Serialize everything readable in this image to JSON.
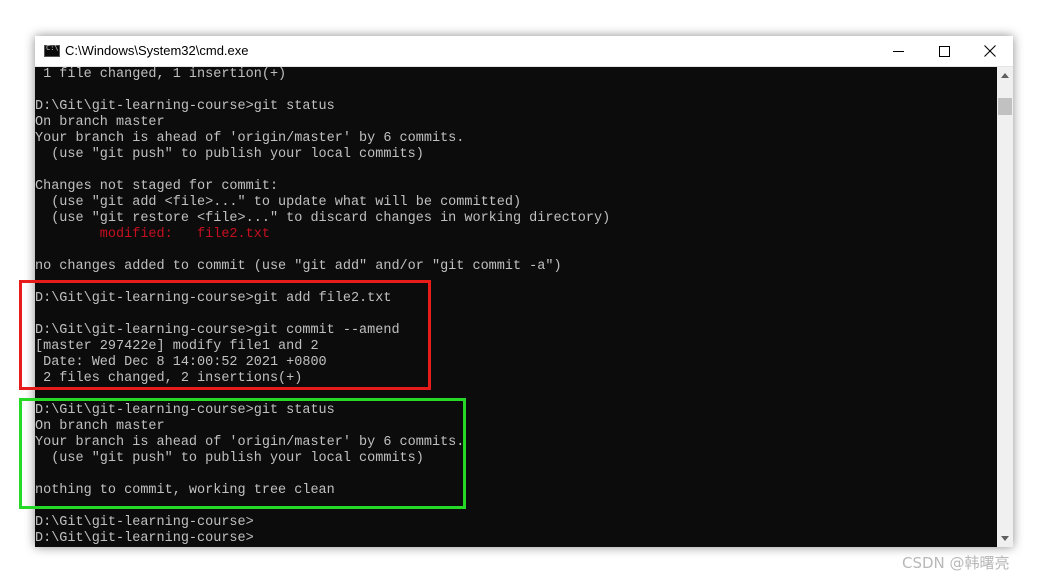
{
  "window": {
    "title": "C:\\Windows\\System32\\cmd.exe",
    "icon": "cmd-icon",
    "controls": [
      "minimize-icon",
      "maximize-icon",
      "close-icon"
    ]
  },
  "colors": {
    "console_bg": "#0c0c0c",
    "console_text": "#c0c0c0",
    "modified_red": "#c50f1f",
    "highlight_red": "#e81b1b",
    "highlight_green": "#26d926"
  },
  "console": {
    "lines": [
      " 1 file changed, 1 insertion(+)",
      "",
      "D:\\Git\\git-learning-course>git status",
      "On branch master",
      "Your branch is ahead of 'origin/master' by 6 commits.",
      "  (use \"git push\" to publish your local commits)",
      "",
      "Changes not staged for commit:",
      "  (use \"git add <file>...\" to update what will be committed)",
      "  (use \"git restore <file>...\" to discard changes in working directory)",
      "        modified:   file2.txt",
      "",
      "no changes added to commit (use \"git add\" and/or \"git commit -a\")",
      "",
      "D:\\Git\\git-learning-course>git add file2.txt",
      "",
      "D:\\Git\\git-learning-course>git commit --amend",
      "[master 297422e] modify file1 and 2",
      " Date: Wed Dec 8 14:00:52 2021 +0800",
      " 2 files changed, 2 insertions(+)",
      "",
      "D:\\Git\\git-learning-course>git status",
      "On branch master",
      "Your branch is ahead of 'origin/master' by 6 commits.",
      "  (use \"git push\" to publish your local commits)",
      "",
      "nothing to commit, working tree clean",
      "",
      "D:\\Git\\git-learning-course>",
      "D:\\Git\\git-learning-course>"
    ]
  },
  "watermark": "CSDN @韩曙亮"
}
